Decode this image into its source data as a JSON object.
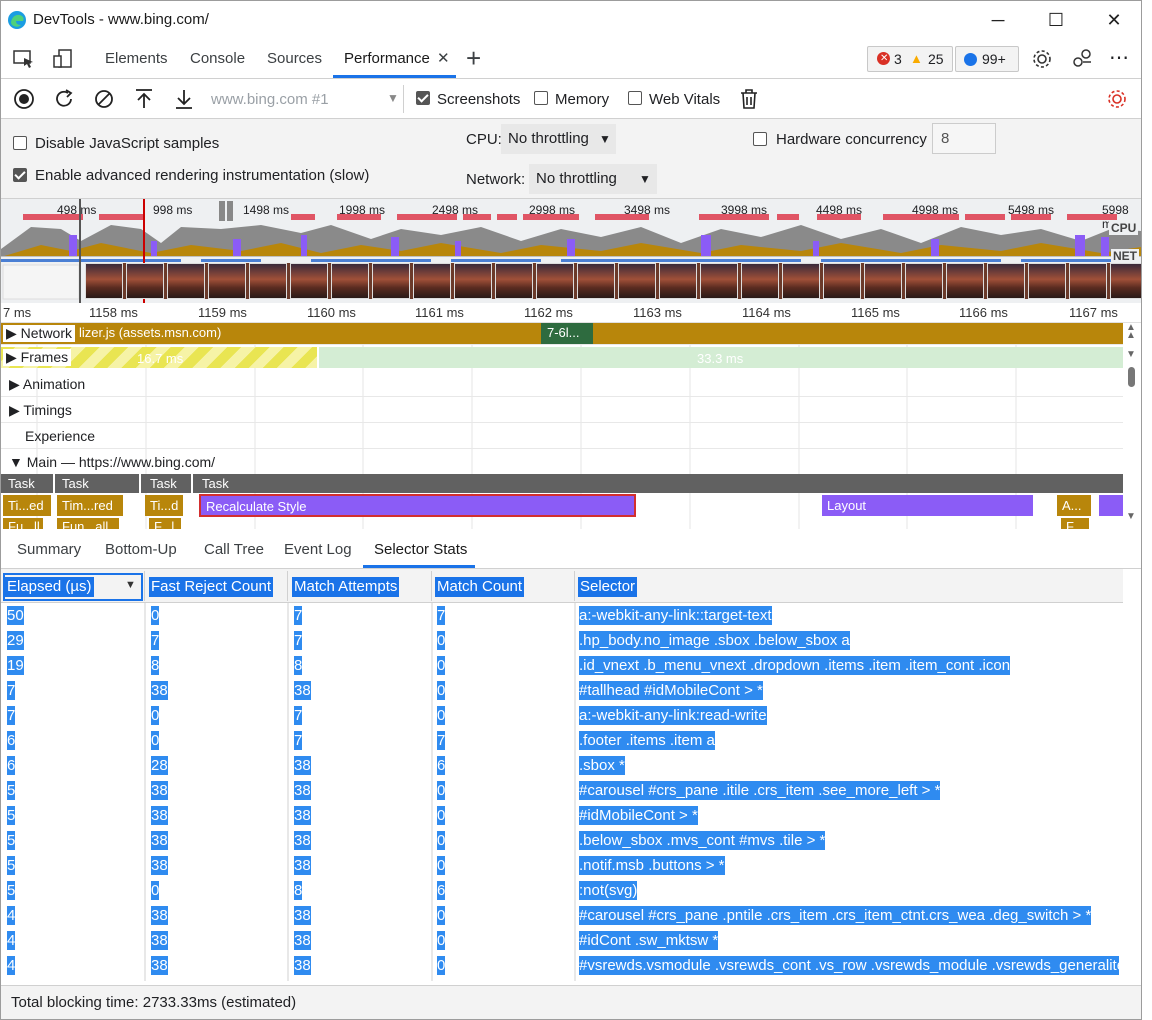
{
  "window": {
    "title": "DevTools - www.bing.com/",
    "min": "─",
    "max": "☐",
    "close": "✕"
  },
  "tabs": [
    {
      "label": "Elements"
    },
    {
      "label": "Console"
    },
    {
      "label": "Sources"
    },
    {
      "label": "Performance",
      "close": "✕"
    }
  ],
  "new_tab": "+",
  "issues": {
    "errors": "3",
    "warnings": "25",
    "messages": "99+"
  },
  "toolbar": {
    "recording_select": "www.bing.com #1",
    "screenshots_label": "Screenshots",
    "screenshots_checked": true,
    "memory_label": "Memory",
    "memory_checked": false,
    "webvitals_label": "Web Vitals",
    "webvitals_checked": false
  },
  "settings": {
    "disable_js_label": "Disable JavaScript samples",
    "advanced_rendering_label": "Enable advanced rendering instrumentation (slow)",
    "cpu_label": "CPU:",
    "cpu_value": "No throttling",
    "network_label": "Network:",
    "network_value": "No throttling",
    "hw_label": "Hardware concurrency",
    "hw_value": "8"
  },
  "overview": {
    "ticks": [
      "498 ms",
      "998 ms",
      "1498 ms",
      "1998 ms",
      "2498 ms",
      "2998 ms",
      "3498 ms",
      "3998 ms",
      "4498 ms",
      "4998 ms",
      "5498 ms",
      "5998 m"
    ],
    "cpu_label": "CPU",
    "net_label": "NET"
  },
  "ruler": [
    "7 ms",
    "1158 ms",
    "1159 ms",
    "1160 ms",
    "1161 ms",
    "1162 ms",
    "1163 ms",
    "1164 ms",
    "1165 ms",
    "1166 ms",
    "1167 ms"
  ],
  "tracks": {
    "network": "Network",
    "network_bar": "lizer.js (assets.msn.com)",
    "network_bar2": "7-6l...",
    "frames": "Frames",
    "frame1": "16.7 ms",
    "frame2": "33.3 ms",
    "animation": "Animation",
    "timings": "Timings",
    "experience": "Experience",
    "main": "Main — https://www.bing.com/"
  },
  "flame": {
    "tasks": [
      "Task",
      "Task",
      "Task",
      "Task"
    ],
    "l2": [
      "Ti...ed",
      "Tim...red",
      "Ti...d",
      "Recalculate Style",
      "Layout",
      "A..."
    ],
    "l3": [
      "Fu...ll",
      "Fun...all",
      "F...l",
      "F..."
    ]
  },
  "bottom_tabs": [
    "Summary",
    "Bottom-Up",
    "Call Tree",
    "Event Log",
    "Selector Stats"
  ],
  "table": {
    "headers": [
      "Elapsed (µs)",
      "Fast Reject Count",
      "Match Attempts",
      "Match Count",
      "Selector"
    ],
    "rows": [
      [
        "50",
        "0",
        "7",
        "7",
        "a:-webkit-any-link::target-text"
      ],
      [
        "29",
        "7",
        "7",
        "0",
        ".hp_body.no_image .sbox .below_sbox a"
      ],
      [
        "19",
        "8",
        "8",
        "0",
        ".id_vnext .b_menu_vnext .dropdown .items .item .item_cont .icon"
      ],
      [
        "7",
        "38",
        "38",
        "0",
        "#tallhead #idMobileCont > *"
      ],
      [
        "7",
        "0",
        "7",
        "0",
        "a:-webkit-any-link:read-write"
      ],
      [
        "6",
        "0",
        "7",
        "7",
        ".footer .items .item a"
      ],
      [
        "6",
        "28",
        "38",
        "6",
        ".sbox *"
      ],
      [
        "5",
        "38",
        "38",
        "0",
        "#carousel #crs_pane .itile .crs_item .see_more_left > *"
      ],
      [
        "5",
        "38",
        "38",
        "0",
        "#idMobileCont > *"
      ],
      [
        "5",
        "38",
        "38",
        "0",
        ".below_sbox .mvs_cont #mvs .tile > *"
      ],
      [
        "5",
        "38",
        "38",
        "0",
        ".notif.msb .buttons > *"
      ],
      [
        "5",
        "0",
        "8",
        "6",
        ":not(svg)"
      ],
      [
        "4",
        "38",
        "38",
        "0",
        "#carousel #crs_pane .pntile .crs_item .crs_item_ctnt.crs_wea .deg_switch > *"
      ],
      [
        "4",
        "38",
        "38",
        "0",
        "#idCont .sw_mktsw *"
      ],
      [
        "4",
        "38",
        "38",
        "0",
        "#vsrewds.vsmodule .vsrewds_cont .vs_row .vsrewds_module .vsrewds_generalite..."
      ]
    ]
  },
  "footer": "Total blocking time: 2733.33ms (estimated)",
  "colors": {
    "accent": "#1a73e8",
    "selection": "#2f8bf0",
    "task": "#616161",
    "timer": "#b8860b",
    "style": "#8b5cf6"
  }
}
